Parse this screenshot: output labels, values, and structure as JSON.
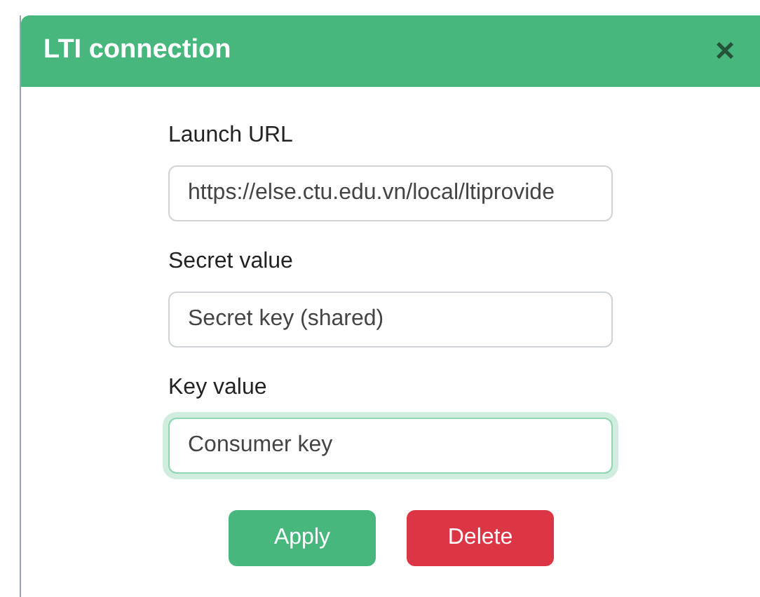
{
  "dialog": {
    "title": "LTI connection",
    "close": "×"
  },
  "fields": [
    {
      "label": "Launch URL",
      "value": "https://else.ctu.edu.vn/local/ltiprovide",
      "focused": false
    },
    {
      "label": "Secret value",
      "value": "Secret key (shared)",
      "focused": false
    },
    {
      "label": "Key value",
      "value": "Consumer key",
      "focused": true
    }
  ],
  "buttons": [
    {
      "label": "Apply",
      "kind": "primary"
    },
    {
      "label": "Delete",
      "kind": "danger"
    }
  ]
}
